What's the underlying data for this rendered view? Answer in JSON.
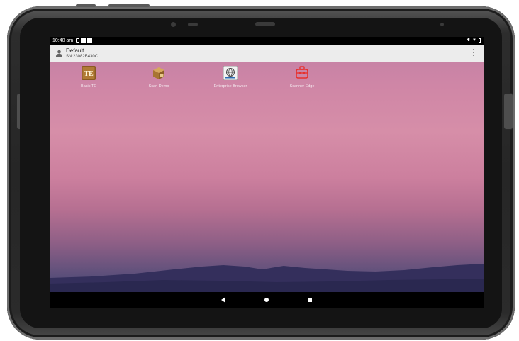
{
  "status_bar": {
    "time": "10:40 am"
  },
  "kiosk_header": {
    "title": "Default",
    "serial": "SN:23082B430C"
  },
  "apps": [
    {
      "label": "Basic TE",
      "icon": "te-terminal-icon"
    },
    {
      "label": "Scan Demo",
      "icon": "scan-box-icon"
    },
    {
      "label": "Enterprise Browser",
      "icon": "globe-browser-icon"
    },
    {
      "label": "Scanner Edge",
      "icon": "scanner-edge-icon"
    }
  ],
  "nav_bar": {
    "back": "back-icon",
    "home": "home-icon",
    "recents": "recents-icon"
  },
  "colors": {
    "wallpaper_top": "#c07fa4",
    "wallpaper_bottom": "#3c3f68",
    "bezel": "#262626",
    "scanner_edge_red": "#e8302c"
  }
}
